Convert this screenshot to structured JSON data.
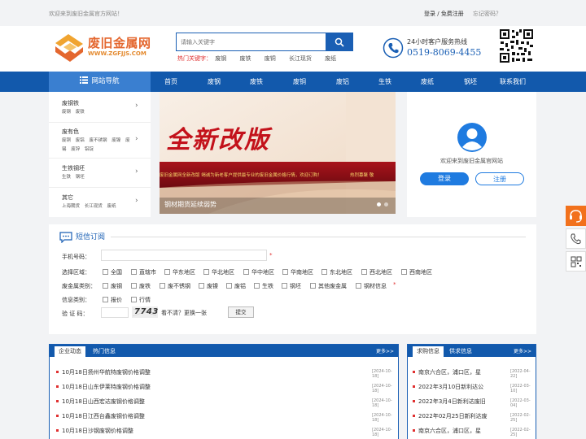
{
  "topbar": {
    "welcome": "欢迎来到废旧金属官方网站！",
    "login": "登录",
    "sep": " / ",
    "register": "免费注册",
    "forgot": "忘记密码？"
  },
  "header": {
    "logo_cn": "废旧金属网",
    "logo_en": "WWW.ZGFJJS.COM",
    "search_placeholder": "请输入关键字",
    "hot_label": "热门关键字：",
    "hot_keywords": [
      "废钢",
      "废铁",
      "废铜",
      "长江现货",
      "废纸"
    ],
    "hotline_label": "24小时客户服务热线",
    "hotline_number": "0519-8069-4455"
  },
  "nav": {
    "site_nav": "网站导航",
    "items": [
      "首页",
      "废钢",
      "废铁",
      "废铜",
      "废铝",
      "生铁",
      "废纸",
      "钢坯",
      "联系我们"
    ]
  },
  "sidebar_categories": [
    {
      "title": "废钢铁",
      "subs": [
        "废钢",
        "废铁"
      ]
    },
    {
      "title": "废有色",
      "subs": [
        "废铜",
        "废铝",
        "废不锈钢",
        "废镍",
        "废锡",
        "废锌",
        "铝锭"
      ]
    },
    {
      "title": "生铁钢坯",
      "subs": [
        "生铁",
        "钢坯"
      ]
    },
    {
      "title": "其它",
      "subs": [
        "上海期货",
        "长江现货",
        "废纸"
      ]
    }
  ],
  "banner": {
    "headline": "全新改版",
    "tagline": "废旧金属网全新改版  竭诚为新老客户提供最专业的废旧金属价格行情，欢迎订购！",
    "tagline2": "热烈募聚  敬",
    "caption": "钢材期货延续弱势",
    "slides": 3,
    "active_slide": 1
  },
  "userbox": {
    "welcome": "欢迎来到废旧金属官网站",
    "login": "登录",
    "register": "注册"
  },
  "sms": {
    "title": "短信订阅",
    "phone_label": "手机号码：",
    "req": "*",
    "region_label": "选择区域：",
    "regions": [
      "全国",
      "直辖市",
      "华东地区",
      "华北地区",
      "华中地区",
      "华南地区",
      "东北地区",
      "西北地区",
      "西南地区"
    ],
    "category_label": "废金属类别：",
    "categories": [
      "废钢",
      "废铁",
      "废不锈钢",
      "废镍",
      "废铝",
      "生铁",
      "钢坯",
      "其他废金属",
      "钢材信息"
    ],
    "info_label": "信息类别：",
    "info_types": [
      "报价",
      "行情"
    ],
    "code_label": "验 证 码：",
    "captcha": "7743",
    "refresh": "看不清？更换一张",
    "submit": "提交"
  },
  "news_panel": {
    "tab_active": "企业动态",
    "tab_inactive": "热门信息",
    "more": "更多>>",
    "items": [
      {
        "title": "10月18日扬州华航特废钢价格调整",
        "date": "[2024-10-18]"
      },
      {
        "title": "10月18日山东伊莱特废钢价格调整",
        "date": "[2024-10-18]"
      },
      {
        "title": "10月18日山西宏达废钢价格调整",
        "date": "[2024-10-18]"
      },
      {
        "title": "10月18日江西台鑫废钢价格调整",
        "date": "[2024-10-18]"
      },
      {
        "title": "10月18日沙钢废钢价格调整",
        "date": "[2024-10-18]"
      }
    ]
  },
  "buy_panel": {
    "tab_active": "求购信息",
    "tab_inactive": "供求信息",
    "more": "更多>>",
    "items": [
      {
        "title": "南京六合区，浦口区，星",
        "date": "[2022-04-22]"
      },
      {
        "title": "2022年3月10日新利达公",
        "date": "[2022-03-10]"
      },
      {
        "title": "2022年3月4日新利达废旧",
        "date": "[2022-03-04]"
      },
      {
        "title": "2022年02月25日新利达废",
        "date": "[2022-02-25]"
      },
      {
        "title": "南京六合区，浦口区，星",
        "date": "[2022-02-25]"
      }
    ]
  },
  "colors": {
    "nav_blue": "#1259ac",
    "accent_orange": "#f2711c",
    "red": "#e03030"
  }
}
